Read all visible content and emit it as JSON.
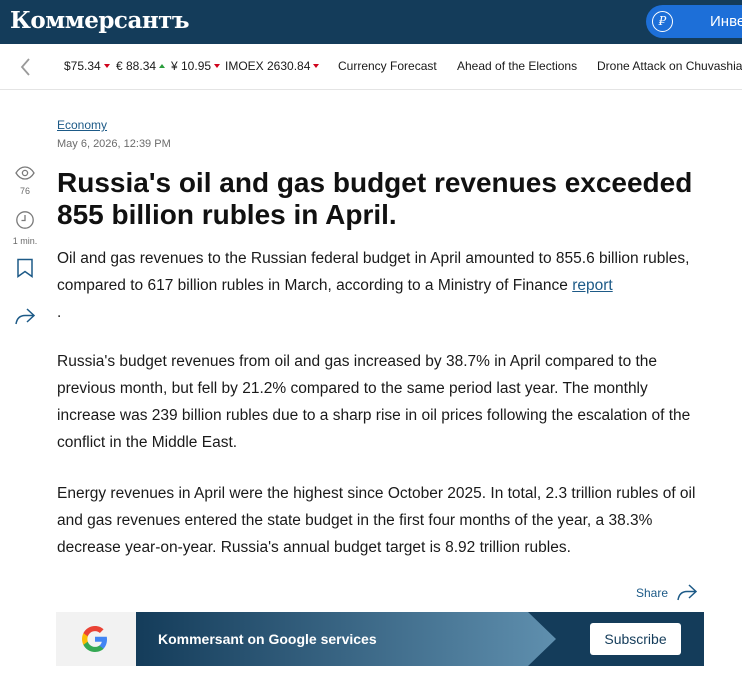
{
  "header": {
    "logo": "Коммерсантъ",
    "invest_label": "Инве",
    "colors": {
      "bar": "#143c5a",
      "pill": "#1d6fd8"
    }
  },
  "tickers": {
    "back_icon": "chevron-left-icon",
    "items": [
      {
        "label": "$75.34",
        "trend": "down"
      },
      {
        "label": "€ 88.34",
        "trend": "up"
      },
      {
        "label": "¥ 10.95",
        "trend": "down"
      },
      {
        "label": "IMOEX 2630.84",
        "trend": "down"
      }
    ],
    "topics": [
      "Currency Forecast",
      "Ahead of the Elections",
      "Drone Attack on Chuvashia"
    ]
  },
  "rail": {
    "views": "76",
    "read_time": "1 min."
  },
  "article": {
    "category": "Economy",
    "date": "May 6, 2026, 12:39 PM",
    "title": "Russia's oil and gas budget revenues exceeded 855 billion rubles in April.",
    "p1_text": "Oil and gas revenues to the Russian federal budget in April amounted to 855.6 billion rubles, compared to 617 billion rubles in March, according to a Ministry of Finance ",
    "p1_link": "report",
    "p1_end": ".",
    "p2": "Russia's budget revenues from oil and gas increased by 38.7% in April compared to the previous month, but fell by 21.2% compared to the same period last year. The monthly increase was 239 billion rubles due to a sharp rise in oil prices following the escalation of the conflict in the Middle East.",
    "p3": "Energy revenues in April were the highest since October 2025. In total, 2.3 trillion rubles of oil and gas revenues entered the state budget in the first four months of the year, a 38.3% decrease year-on-year. Russia's annual budget target is 8.92 trillion rubles.",
    "share_label": "Share"
  },
  "banner": {
    "text": "Kommersant on Google services",
    "button": "Subscribe"
  }
}
